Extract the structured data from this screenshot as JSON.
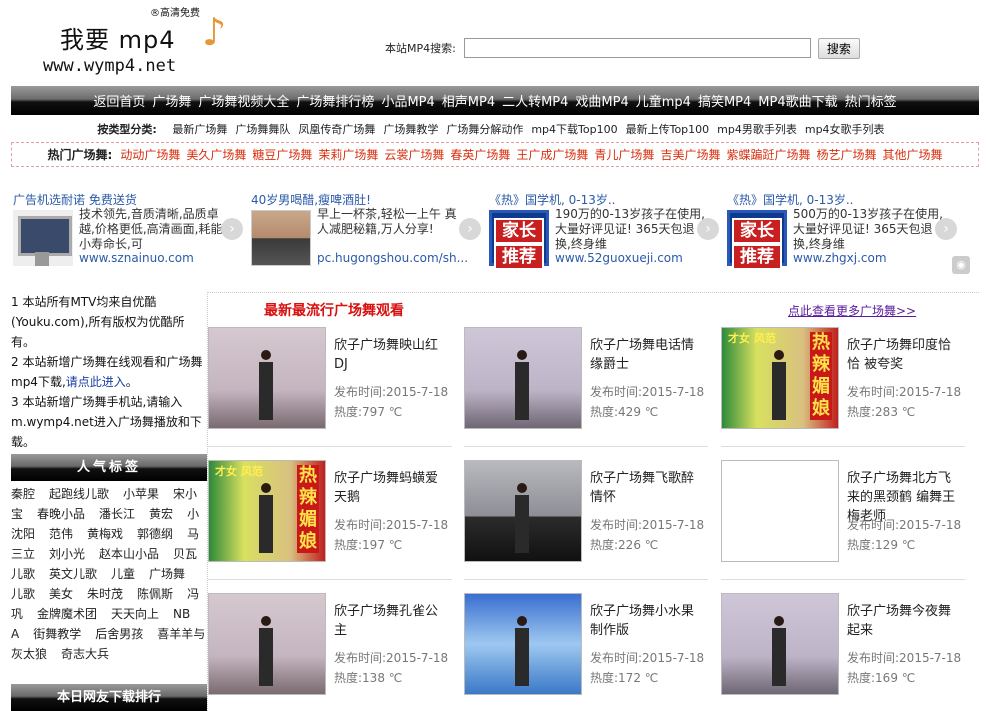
{
  "header": {
    "logo_line1": "我要 mp4",
    "logo_line2": "www.wymp4.net",
    "logo_tag": "®高清免费",
    "logo_icon": "music-note-icon",
    "search_label": "本站MP4搜索:",
    "search_value": "",
    "search_button": "搜索"
  },
  "nav": [
    "返回首页",
    "广场舞",
    "广场舞视频大全",
    "广场舞排行榜",
    "小品MP4",
    "相声MP4",
    "二人转MP4",
    "戏曲MP4",
    "儿童mp4",
    "搞笑MP4",
    "MP4歌曲下载",
    "热门标签"
  ],
  "category": {
    "label": "按类型分类:",
    "items": [
      "最新广场舞",
      "广场舞舞队",
      "凤凰传奇广场舞",
      "广场舞教学",
      "广场舞分解动作",
      "mp4下载Top100",
      "最新上传Top100",
      "mp4男歌手列表",
      "mp4女歌手列表"
    ]
  },
  "hot": {
    "label": "热门广场舞:",
    "items": [
      "动动广场舞",
      "美久广场舞",
      "糖豆广场舞",
      "茉莉广场舞",
      "云裳广场舞",
      "春英广场舞",
      "王广成广场舞",
      "青儿广场舞",
      "吉美广场舞",
      "紫蝶蹁跹广场舞",
      "杨艺广场舞",
      "其他广场舞"
    ]
  },
  "ads": [
    {
      "title": "广告机选耐诺 免费送货",
      "desc": "技术领先,音质清晰,品质卓越,价格更低,高清画面,耗能小寿命长,可",
      "url": "www.sznainuo.com",
      "img": "kiosk"
    },
    {
      "title": "40岁男喝醋,瘦啤酒肚!",
      "desc": "早上一杯茶,轻松一上午 真人减肥秘籍,万人分享!",
      "url": "pc.hugongshou.com/sh...",
      "img": "face"
    },
    {
      "title": "《热》国学机, 0-13岁..",
      "desc": "190万的0-13岁孩子在使用,大量好评见证! 365天包退换,终身维",
      "url": "www.52guoxueji.com",
      "img": "badge"
    },
    {
      "title": "《热》国学机, 0-13岁..",
      "desc": "500万的0-13岁孩子在使用,大量好评见证! 365天包退换,终身维",
      "url": "www.zhgxj.com",
      "img": "badge"
    }
  ],
  "ad_badge_text": [
    "家长",
    "推荐"
  ],
  "notice": {
    "n1": "1 本站所有MTV均来自优酷(Youku.com),所有版权为优酷所有。",
    "n2_pre": "2 本站新增广场舞在线观看和广场舞mp4下载,",
    "n2_link": "请点此进入",
    "n2_post": "。",
    "n3": "3 本站新增广场舞手机站,请输入m.wymp4.net进入广场舞播放和下载。"
  },
  "popular_tags": {
    "title": "人气标签",
    "items": [
      "秦腔",
      "起跑线儿歌",
      "小苹果",
      "宋小宝",
      "春晚小品",
      "潘长江",
      "黄宏",
      "小沈阳",
      "范伟",
      "黄梅戏",
      "郭德纲",
      "马三立",
      "刘小光",
      "赵本山小品",
      "贝瓦儿歌",
      "英文儿歌",
      "儿童",
      "广场舞",
      "儿歌",
      "美女",
      "朱时茂",
      "陈佩斯",
      "冯巩",
      "金牌魔术团",
      "天天向上",
      "NBA",
      "街舞教学",
      "后舍男孩",
      "喜羊羊与灰太狼",
      "奇志大兵"
    ]
  },
  "download_rank_title": "本日网友下载排行",
  "section": {
    "title": "最新最流行广场舞观看",
    "more": "点此查看更多广场舞>>"
  },
  "videos": [
    {
      "title": "欣子广场舞映山红DJ",
      "date": "发布时间:2015-7-18",
      "heat": "热度:797 ℃",
      "thumb": "c-stage"
    },
    {
      "title": "欣子广场舞电话情缘爵士",
      "date": "发布时间:2015-7-18",
      "heat": "热度:429 ℃",
      "thumb": "c-stage2"
    },
    {
      "title": "欣子广场舞印度恰恰 被夸奖",
      "date": "发布时间:2015-7-18",
      "heat": "热度:283 ℃",
      "thumb": "c-poster"
    },
    {
      "title": "欣子广场舞蚂蟥爱天鹅",
      "date": "发布时间:2015-7-18",
      "heat": "热度:197 ℃",
      "thumb": "c-poster"
    },
    {
      "title": "欣子广场舞飞歌醉情怀",
      "date": "发布时间:2015-7-18",
      "heat": "热度:226 ℃",
      "thumb": "c-dark"
    },
    {
      "title": "欣子广场舞北方飞来的黑颈鹤 编舞王梅老师",
      "date": "发布时间:2015-7-18",
      "heat": "热度:129 ℃",
      "thumb": "c-blank"
    },
    {
      "title": "欣子广场舞孔雀公主",
      "date": "发布时间:2015-7-18",
      "heat": "热度:138 ℃",
      "thumb": "c-stage"
    },
    {
      "title": "欣子广场舞小水果制作版",
      "date": "发布时间:2015-7-18",
      "heat": "热度:172 ℃",
      "thumb": "c-blue"
    },
    {
      "title": "欣子广场舞今夜舞起来",
      "date": "发布时间:2015-7-18",
      "heat": "热度:169 ℃",
      "thumb": "c-stage2"
    }
  ],
  "poster_text": {
    "top": "才女 风范",
    "vertical": "热辣媚娘"
  }
}
